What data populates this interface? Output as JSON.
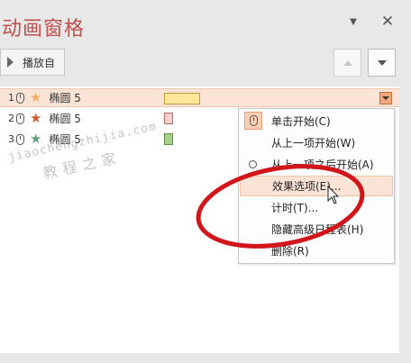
{
  "pane": {
    "title": "动画窗格",
    "dropdown_icon": "triangle-down",
    "close_icon": "x"
  },
  "toolbar": {
    "play_label": "播放自",
    "move_up_icon": "triangle-up",
    "move_down_icon": "triangle-down"
  },
  "animations": [
    {
      "number": "1",
      "trigger_icon": "mouse-icon",
      "effect_icon": "star",
      "star_color": "#f2b366",
      "name": "椭圆 5",
      "bar_color": "#ffe699",
      "bar_border": "#b99a35",
      "selected": true
    },
    {
      "number": "2",
      "trigger_icon": "mouse-icon",
      "effect_icon": "star",
      "star_color": "#d35a35",
      "name": "椭圆 5",
      "bar_color": "#ffcccc",
      "bar_border": "#b06b6b",
      "selected": false
    },
    {
      "number": "3",
      "trigger_icon": "mouse-icon",
      "effect_icon": "star",
      "star_color": "#5ea27f",
      "name": "椭圆 5",
      "bar_color": "#a9d18e",
      "bar_border": "#5f8f45",
      "selected": false
    }
  ],
  "context_menu": {
    "items": [
      {
        "label": "单击开始(C)",
        "icon": "mouse-icon"
      },
      {
        "label": "从上一项开始(W)",
        "icon": ""
      },
      {
        "label": "从上一项之后开始(A)",
        "icon": "clock-icon"
      },
      {
        "label": "效果选项(E)...",
        "icon": "",
        "hover": true
      },
      {
        "label": "计时(T)...",
        "icon": ""
      },
      {
        "label": "隐藏高级日程表(H)",
        "icon": ""
      },
      {
        "label": "删除(R)",
        "icon": ""
      }
    ]
  },
  "watermark": {
    "line1": "jiaochengzhijia.com",
    "line2": "教程之家"
  },
  "colors": {
    "title": "#c0504d",
    "selection": "#fbe3d6",
    "annotation": "#d0161b"
  }
}
